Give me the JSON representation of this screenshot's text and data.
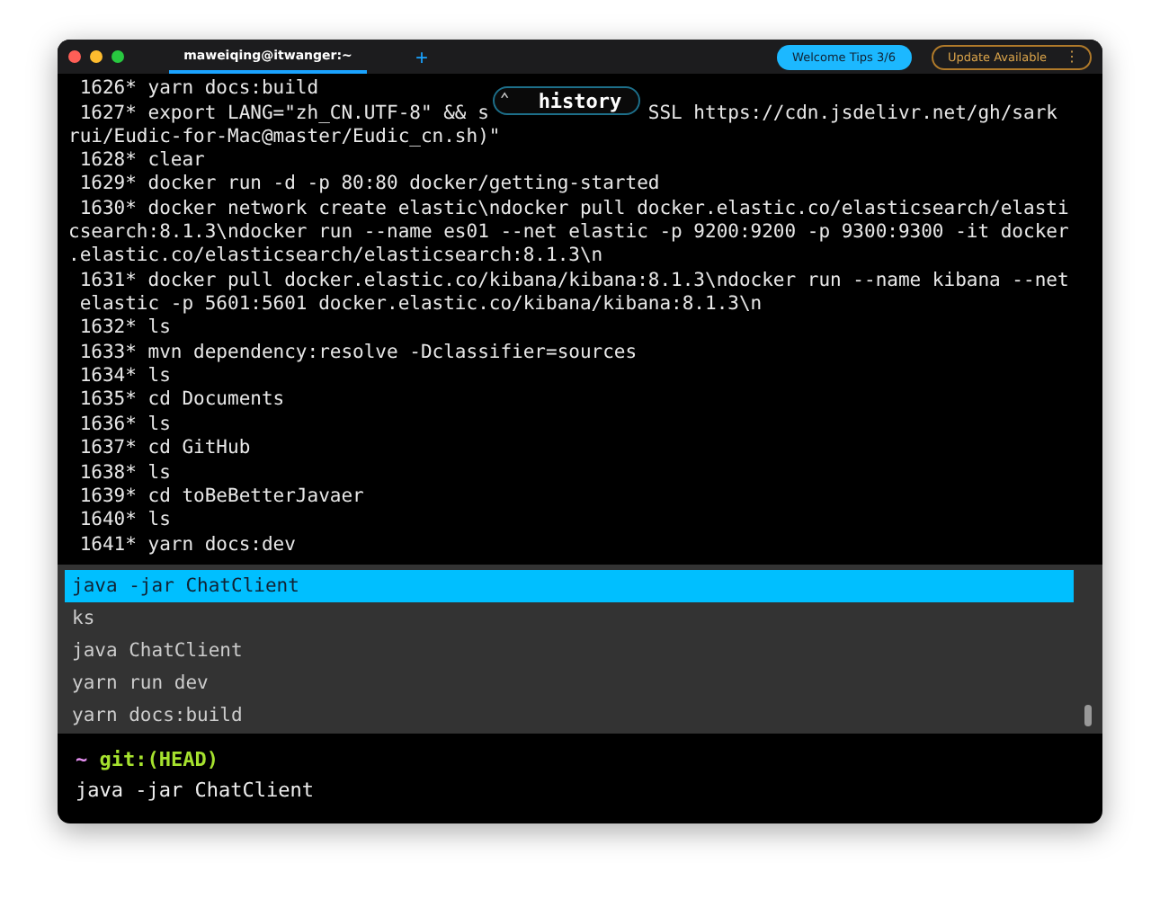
{
  "window": {
    "tab": {
      "title": "maweiqing@itwanger:~",
      "selected": true
    },
    "new_tab": "+",
    "welcome_tips": "Welcome Tips 3/6",
    "update": {
      "label": "Update Available",
      "menu": "⋮"
    }
  },
  "history_badge": {
    "label": "history",
    "icon": "⌃"
  },
  "lines": [
    {
      "text": "1626* yarn docs:build"
    },
    {
      "text": "1627* export LANG=\"zh_CN.UTF-8\" && s",
      "after": "SSL https://cdn.jsdelivr.net/gh/sark"
    },
    {
      "text": "rui/Eudic-for-Mac@master/Eudic_cn.sh)\"",
      "wrap": true
    },
    {
      "text": "1628* clear"
    },
    {
      "text": "1629* docker run -d -p 80:80 docker/getting-started"
    },
    {
      "text": "1630* docker network create elastic\\ndocker pull docker.elastic.co/elasticsearch/elasti"
    },
    {
      "text": "csearch:8.1.3\\ndocker run --name es01 --net elastic -p 9200:9200 -p 9300:9300 -it docker",
      "wrap": true
    },
    {
      "text": ".elastic.co/elasticsearch/elasticsearch:8.1.3\\n",
      "wrap": true
    },
    {
      "text": "1631* docker pull docker.elastic.co/kibana/kibana:8.1.3\\ndocker run --name kibana --net"
    },
    {
      "text": "elastic -p 5601:5601 docker.elastic.co/kibana/kibana:8.1.3\\n",
      "wrap": false
    },
    {
      "text": "1632* ls"
    },
    {
      "text": "1633* mvn dependency:resolve -Dclassifier=sources"
    },
    {
      "text": "1634* ls"
    },
    {
      "text": "1635* cd Documents"
    },
    {
      "text": "1636* ls"
    },
    {
      "text": "1637* cd GitHub"
    },
    {
      "text": "1638* ls"
    },
    {
      "text": "1639* cd toBeBetterJavaer"
    },
    {
      "text": "1640* ls"
    },
    {
      "text": "1641* yarn docs:dev"
    }
  ],
  "suggestions": [
    {
      "text": "java -jar ChatClient",
      "selected": true
    },
    {
      "text": "ks",
      "selected": false
    },
    {
      "text": "java ChatClient",
      "selected": false
    },
    {
      "text": "yarn run dev",
      "selected": false
    },
    {
      "text": "yarn docs:build",
      "selected": false
    }
  ],
  "prompt": {
    "dir": "~",
    "branch": "git:(HEAD)",
    "input": "java -jar ChatClient"
  }
}
